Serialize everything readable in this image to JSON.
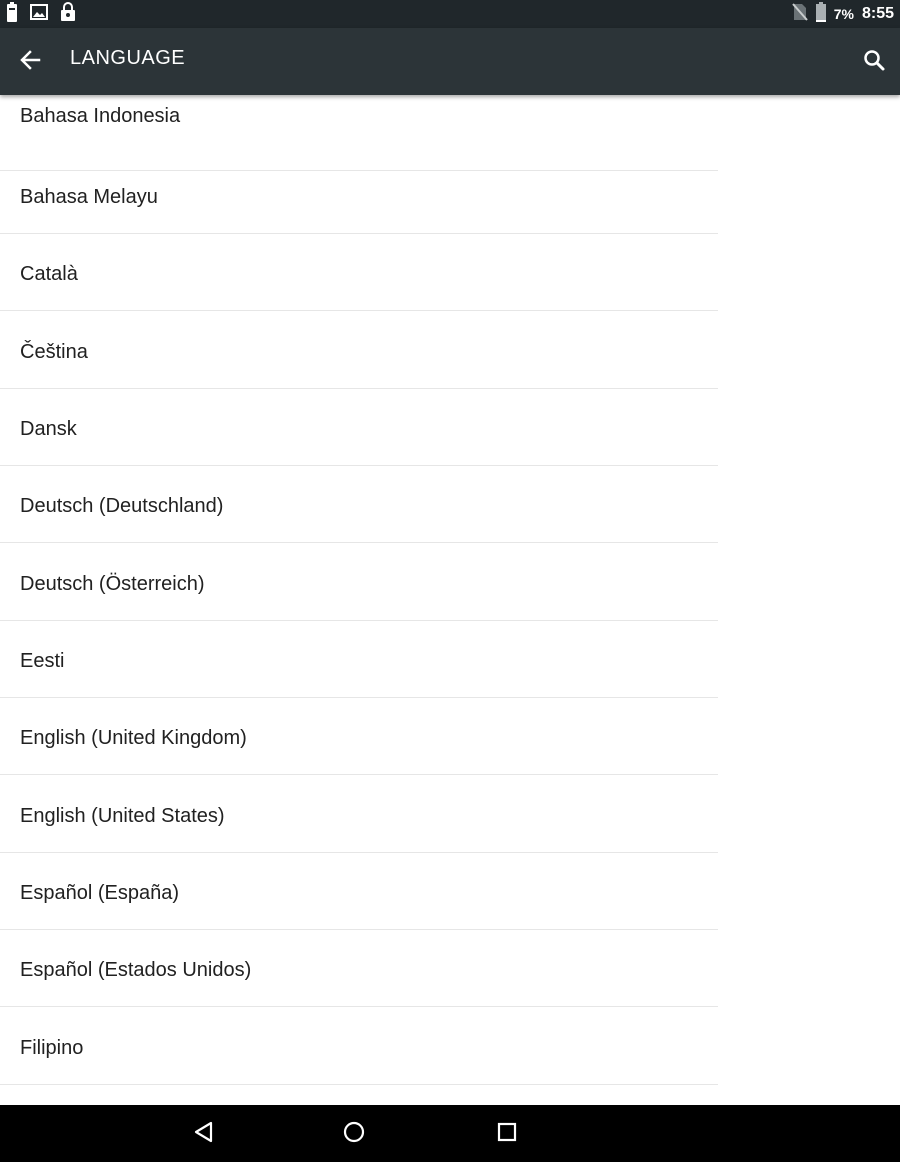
{
  "status_bar": {
    "battery_percent": "7%",
    "time": "8:55",
    "left_icons": [
      "battery-saver-icon",
      "image-icon",
      "lock-icon"
    ],
    "right_icons": [
      "no-sim-icon",
      "battery-icon"
    ]
  },
  "app_bar": {
    "title": "LANGUAGE",
    "back_icon": "arrow-left-icon",
    "search_icon": "search-icon"
  },
  "languages": [
    "Bahasa Indonesia",
    "Bahasa Melayu",
    "Català",
    "Čeština",
    "Dansk",
    "Deutsch (Deutschland)",
    "Deutsch (Österreich)",
    "Eesti",
    "English (United Kingdom)",
    "English (United States)",
    "Español (España)",
    "Español (Estados Unidos)",
    "Filipino"
  ],
  "nav_bar": {
    "icons": [
      "back-triangle-icon",
      "home-circle-icon",
      "recents-square-icon"
    ]
  },
  "colors": {
    "status_bar_bg": "#20272b",
    "app_bar_bg": "#2c3438",
    "divider": "#e6e6e6",
    "text": "#212121"
  }
}
